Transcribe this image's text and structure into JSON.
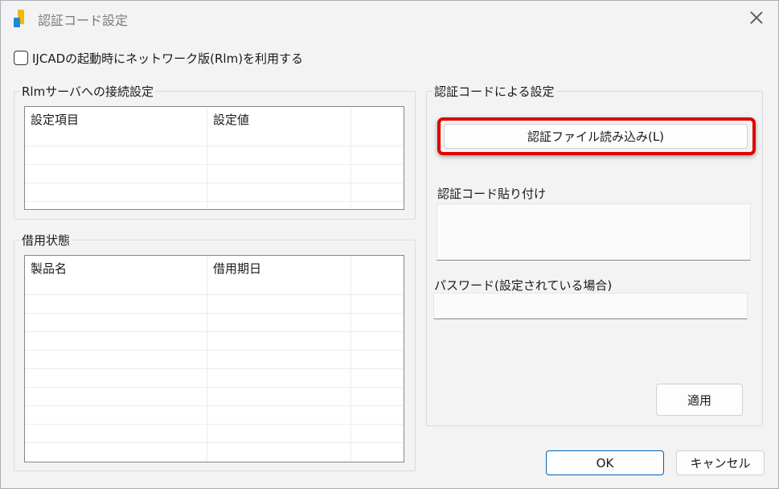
{
  "window": {
    "title": "認証コード設定"
  },
  "options": {
    "use_network_label": "IJCADの起動時にネットワーク版(Rlm)を利用する",
    "use_network_checked": false
  },
  "rlm_group": {
    "title": "Rlmサーバへの接続設定",
    "columns": [
      "設定項目",
      "設定値"
    ],
    "rows": []
  },
  "borrow_group": {
    "title": "借用状態",
    "columns": [
      "製品名",
      "借用期日"
    ],
    "rows": []
  },
  "auth_group": {
    "title": "認証コードによる設定",
    "load_button": "認証ファイル読み込み(L)",
    "paste_label": "認証コード貼り付け",
    "paste_value": "",
    "password_label": "パスワード(設定されている場合)",
    "password_value": "",
    "apply_button": "適用"
  },
  "footer": {
    "ok_button": "OK",
    "cancel_button": "キャンセル"
  },
  "colors": {
    "highlight": "#e00000",
    "primary_border": "#005fb8"
  }
}
